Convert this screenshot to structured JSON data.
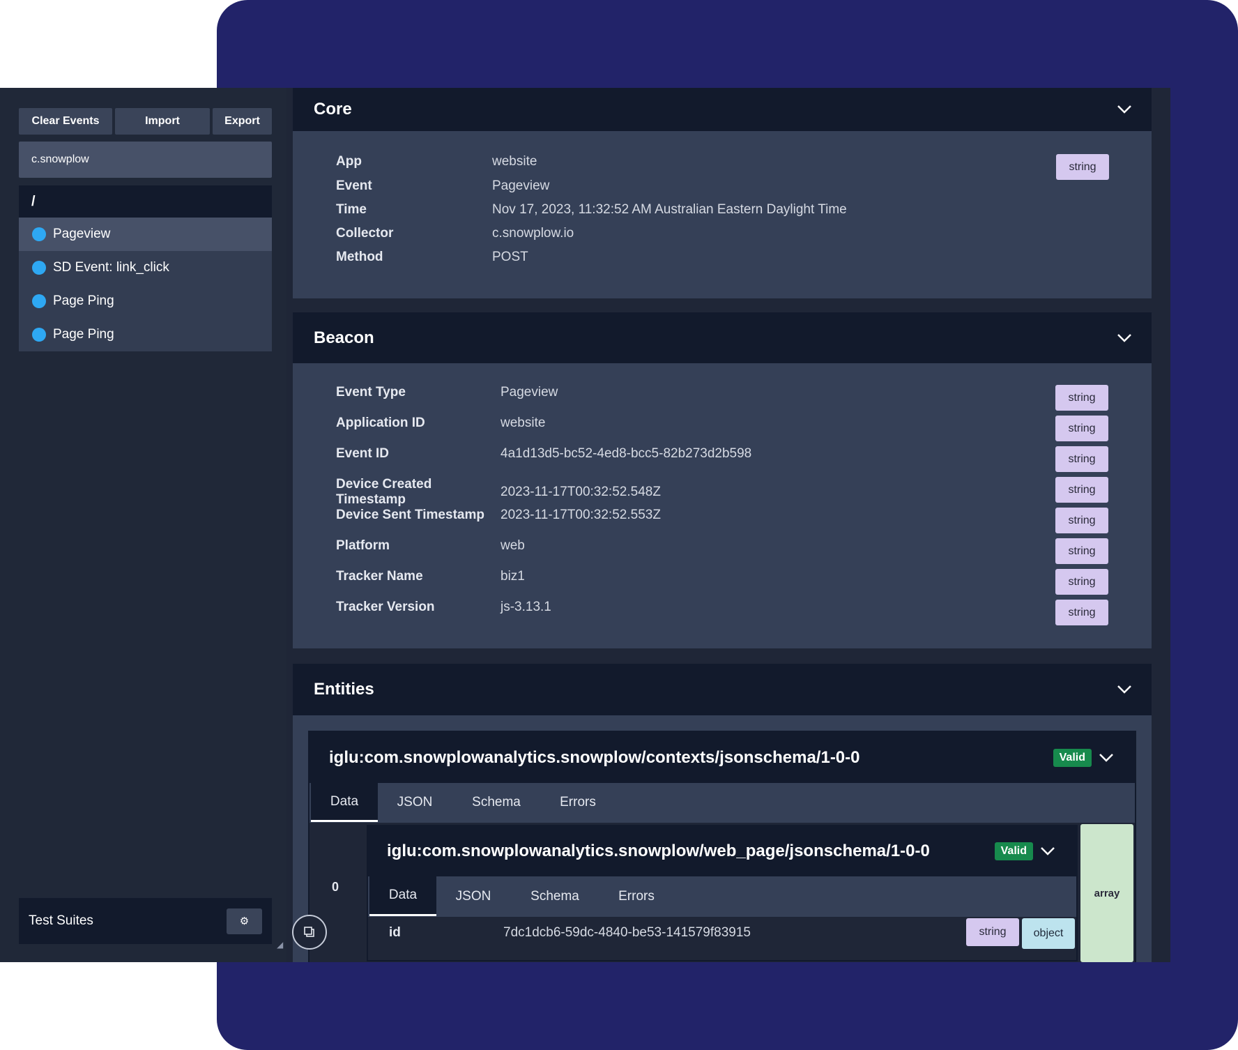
{
  "toolbar": {
    "clear_label": "Clear Events",
    "import_label": "Import",
    "export_label": "Export"
  },
  "filter": {
    "value": "c.snowplow"
  },
  "events": {
    "group": "/",
    "items": [
      {
        "label": "Pageview"
      },
      {
        "label": "SD Event: link_click"
      },
      {
        "label": "Page Ping"
      },
      {
        "label": "Page Ping"
      }
    ]
  },
  "test_suites": {
    "label": "Test Suites"
  },
  "core": {
    "title": "Core",
    "type_tag": "string",
    "rows": [
      {
        "key": "App",
        "value": "website"
      },
      {
        "key": "Event",
        "value": "Pageview"
      },
      {
        "key": "Time",
        "value": "Nov 17, 2023, 11:32:52 AM Australian Eastern Daylight Time"
      },
      {
        "key": "Collector",
        "value": "c.snowplow.io"
      },
      {
        "key": "Method",
        "value": "POST"
      }
    ]
  },
  "beacon": {
    "title": "Beacon",
    "rows": [
      {
        "key": "Event Type",
        "value": "Pageview",
        "type": "string"
      },
      {
        "key": "Application ID",
        "value": "website",
        "type": "string"
      },
      {
        "key": "Event ID",
        "value": "4a1d13d5-bc52-4ed8-bcc5-82b273d2b598",
        "type": "string"
      },
      {
        "key": "Device Created Timestamp",
        "value": "2023-11-17T00:32:52.548Z",
        "type": "string"
      },
      {
        "key": "Device Sent Timestamp",
        "value": "2023-11-17T00:32:52.553Z",
        "type": "string"
      },
      {
        "key": "Platform",
        "value": "web",
        "type": "string"
      },
      {
        "key": "Tracker Name",
        "value": "biz1",
        "type": "string"
      },
      {
        "key": "Tracker Version",
        "value": "js-3.13.1",
        "type": "string"
      }
    ]
  },
  "entities": {
    "title": "Entities",
    "outer": {
      "schema": "iglu:com.snowplowanalytics.snowplow/contexts/jsonschema/1-0-0",
      "status": "Valid",
      "tabs": [
        "Data",
        "JSON",
        "Schema",
        "Errors"
      ],
      "index": "0",
      "type": "array"
    },
    "inner": {
      "schema": "iglu:com.snowplowanalytics.snowplow/web_page/jsonschema/1-0-0",
      "status": "Valid",
      "tabs": [
        "Data",
        "JSON",
        "Schema",
        "Errors"
      ],
      "field_key": "id",
      "field_value": "7dc1dcb6-59dc-4840-be53-141579f83915",
      "field_type": "string",
      "container_type": "object"
    }
  },
  "colors": {
    "accent_bg": "#222369",
    "valid": "#178a4d",
    "event_dot": "#2ea8f3"
  }
}
